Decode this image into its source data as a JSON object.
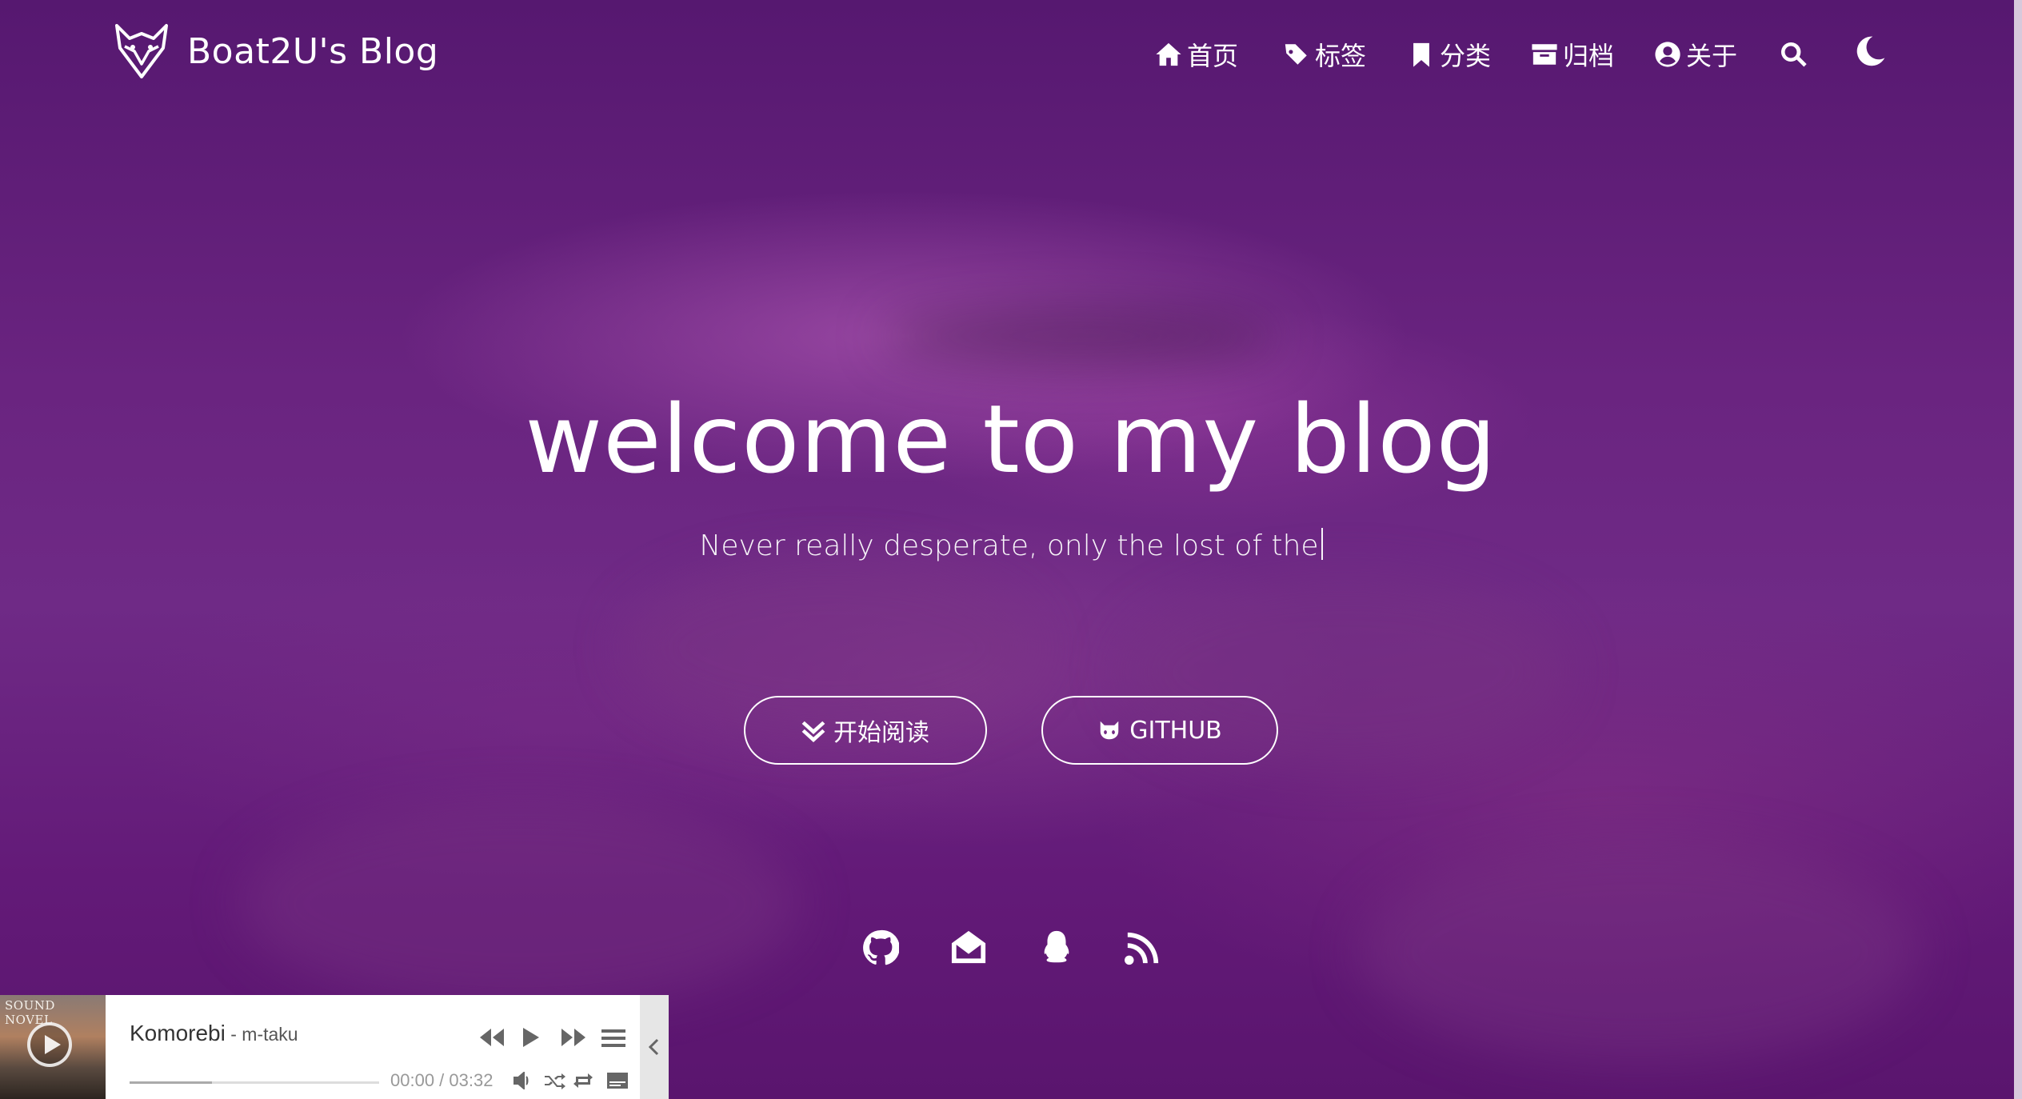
{
  "site": {
    "title": "Boat2U's Blog"
  },
  "nav": {
    "items": [
      {
        "label": "首页",
        "icon": "home-icon"
      },
      {
        "label": "标签",
        "icon": "tags-icon"
      },
      {
        "label": "分类",
        "icon": "bookmark-icon"
      },
      {
        "label": "归档",
        "icon": "archive-icon"
      },
      {
        "label": "关于",
        "icon": "user-circle-icon"
      }
    ],
    "search_icon": "search-icon",
    "theme_icon": "moon-icon"
  },
  "hero": {
    "title": "welcome to my blog",
    "subtitle": "Never really desperate, only the lost of the",
    "buttons": {
      "read": {
        "label": "开始阅读",
        "icon": "double-chevron-down-icon"
      },
      "github": {
        "label": "GITHUB",
        "icon": "github-icon"
      }
    },
    "social_icons": [
      "github-icon",
      "envelope-open-icon",
      "qq-icon",
      "rss-icon"
    ]
  },
  "player": {
    "cover_label": "SOUND NOVEL",
    "song": "Komorebi",
    "artist": " - m-taku",
    "current_time": "00:00",
    "separator": " / ",
    "total_time": "03:32",
    "progress_loaded_fraction": 0.33,
    "accent_color": "#666666"
  },
  "colors": {
    "background": "#5e1a72",
    "text": "#ffffff"
  }
}
